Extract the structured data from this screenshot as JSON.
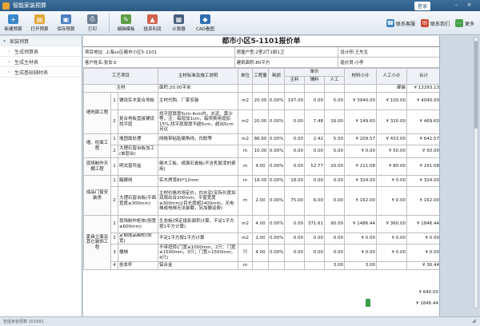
{
  "window": {
    "title": "智能家装预算",
    "login": "登录",
    "minimize": "–",
    "close": "×"
  },
  "toolbar": {
    "buttons": [
      {
        "label": "新建预算",
        "icon": "new-icon",
        "color": "#3a86c8",
        "glyph": "+"
      },
      {
        "label": "打开预算",
        "icon": "folder-icon",
        "color": "#e1a83a",
        "glyph": "▤"
      },
      {
        "label": "保存预算",
        "icon": "save-icon",
        "color": "#4a7fbf",
        "glyph": "▣"
      },
      {
        "label": "打印",
        "icon": "print-icon",
        "color": "#6b7d92",
        "glyph": "⎙"
      },
      {
        "label": "编辑模板",
        "icon": "edit-icon",
        "color": "#5f9c47",
        "glyph": "✎"
      },
      {
        "label": "投资利润",
        "icon": "chart-icon",
        "color": "#d0634a",
        "glyph": "▲"
      },
      {
        "label": "计算器",
        "icon": "calculator-icon",
        "color": "#4a5f7c",
        "glyph": "▦"
      },
      {
        "label": "CAD看图",
        "icon": "cad-icon",
        "color": "#2f6fb0",
        "glyph": "◆"
      }
    ],
    "right": [
      {
        "label": "联系客服",
        "icon": "service-icon",
        "color": "#3a86c8",
        "glyph": "☎"
      },
      {
        "label": "联系我们",
        "icon": "contact-icon",
        "color": "#d04a3a",
        "glyph": "✉"
      },
      {
        "label": "更多",
        "icon": "more-icon",
        "color": "#4aa04a",
        "glyph": "⋯"
      }
    ]
  },
  "sidebar": {
    "items": [
      {
        "label": "家装预算",
        "level": "top"
      },
      {
        "label": "生成预算表",
        "level": "sub"
      },
      {
        "label": "生成主材表",
        "level": "sub"
      },
      {
        "label": "生成基础辅材表",
        "level": "sub"
      }
    ]
  },
  "sheet": {
    "title": "都市小区5-1101报价单",
    "info1": {
      "addr": "项目地址: 上海xx区都市小区5-1101",
      "house": "房屋户型:2室2厅1厨1卫",
      "designer": "设计师:王先生"
    },
    "info2": {
      "client": "客户姓名:张女士",
      "area": "建筑面积:80平方",
      "auditor": "造价员:小李"
    },
    "headers": {
      "project": "工艺项目",
      "material": "主材标准及施工说明",
      "unit": "单位",
      "qty": "工程量",
      "loss": "耗损",
      "price": "单价",
      "main": "主料",
      "aux": "辅料",
      "labor": "人工",
      "mat_sub": "材料小计",
      "labor_sub": "人工小计",
      "total": "合计"
    },
    "rows": [
      {
        "cat": "主材",
        "no": "",
        "name": "",
        "desc": "面积:20.00平米",
        "unit": "",
        "qty": "",
        "loss": "",
        "main": "",
        "aux": "",
        "labor": "",
        "ms": "",
        "ls": "硬装",
        "total": "¥ 13293.13"
      },
      {
        "cat": "墙地面工程",
        "no": "1",
        "name": "铺设实木复合地板",
        "desc": "主材代购、厂家安装",
        "unit": "m2",
        "qty": "20.00",
        "loss": "0.00%",
        "main": "197.00",
        "aux": "0.00",
        "labor": "5.00",
        "ms": "¥ 3940.00",
        "ls": "¥ 100.00",
        "total": "¥ 4040.00"
      },
      {
        "cat": "",
        "no": "2",
        "name": "复合地板直接铺设找平层",
        "desc": "找平层厚度5cm-4cm内，水泥、黄沙等，注：每增加1cm，每项费用增加15%;找平层厚度不超5cm，超出5cm另议",
        "unit": "m2",
        "qty": "20.00",
        "loss": "0.00%",
        "main": "0.00",
        "aux": "7.48",
        "labor": "16.00",
        "ms": "¥ 149.60",
        "ls": "¥ 320.00",
        "total": "¥ 469.60"
      },
      {
        "cat": "墙、柱面工程",
        "no": "1",
        "name": "墙固面处理",
        "desc": "网格带粘贴偏角线，白胶等",
        "unit": "m2",
        "qty": "86.60",
        "loss": "0.00%",
        "main": "0.00",
        "aux": "2.42",
        "labor": "5.00",
        "ms": "¥ 209.57",
        "ls": "¥ 433.00",
        "total": "¥ 642.57"
      },
      {
        "cat": "",
        "no": "2",
        "name": "大理石窗台板加工(单层台)",
        "desc": "",
        "unit": "m",
        "qty": "10.00",
        "loss": "0.00%",
        "main": "0.00",
        "aux": "0.00",
        "labor": "5.00",
        "ms": "¥ 0.00",
        "ls": "¥ 50.00",
        "total": "¥ 50.00"
      },
      {
        "cat": "现场制作天棚工程",
        "no": "1",
        "name": "明式窗帘盒",
        "desc": "细木工板、纸面石膏板(不含乳胶漆的费用)",
        "unit": "m",
        "qty": "4.00",
        "loss": "0.00%",
        "main": "0.00",
        "aux": "52.77",
        "labor": "20.00",
        "ms": "¥ 211.08",
        "ls": "¥ 80.00",
        "total": "¥ 291.08"
      },
      {
        "cat": "成品门窗安装类",
        "no": "1",
        "name": "踢脚线",
        "desc": "实木烤漆80*12mm",
        "unit": "m",
        "qty": "18.00",
        "loss": "0.00%",
        "main": "18.00",
        "aux": "0.00",
        "labor": "0.00",
        "ms": "¥ 324.00",
        "ls": "¥ 0.00",
        "total": "¥ 324.00"
      },
      {
        "cat": "",
        "no": "2",
        "name": "大理石窗台板(平面宽度≤300mm)",
        "desc": "主材价格市场定价，白水泥(实际长度如双周出台200mm，平窗宽度≤300mm)(目长度超2400mm，无电梯或电梯无法装载，另加搬运费)",
        "unit": "m",
        "qty": "2.00",
        "loss": "0.00%",
        "main": "75.00",
        "aux": "6.00",
        "labor": "0.00",
        "ms": "¥ 162.00",
        "ls": "¥ 0.00",
        "total": "¥ 162.00"
      },
      {
        "cat": "家具立面及其它装饰工程",
        "no": "1",
        "name": "现场制作柜体(刨宽≤600mm)",
        "desc": "生态板(饰定投影面积计算，不足1平方按1平方计算)",
        "unit": "m2",
        "qty": "4.00",
        "loss": "0.00%",
        "main": "0.00",
        "aux": "371.61",
        "labor": "90.00",
        "ms": "¥ 1486.44",
        "ls": "¥ 360.00",
        "total": "¥ 1846.44"
      },
      {
        "cat": "",
        "no": "2",
        "name": "定制成品橱柜(刨宽)",
        "desc": "不足1平方按1平方计算",
        "unit": "m2",
        "qty": "2.00",
        "loss": "0.00%",
        "main": "0.00",
        "aux": "0.00",
        "labor": "0.00",
        "ms": "¥ 0.00",
        "ls": "¥ 0.00",
        "total": "¥ 0.00"
      },
      {
        "cat": "",
        "no": "3",
        "name": "楼梯",
        "desc": "不带扭转(门宽≤1000mm，2只：门宽≤1500mm，3只；门宽>1500mm，4只)",
        "unit": "只",
        "qty": "4.00",
        "loss": "0.00%",
        "main": "0.00",
        "aux": "0.00",
        "labor": "0.00",
        "ms": "¥ 0.00",
        "ls": "¥ 0.00",
        "total": "¥ 0.00"
      },
      {
        "cat": "",
        "no": "4",
        "name": "挂衣杆",
        "desc": "铝合金",
        "unit": "m",
        "qty": "",
        "loss": "",
        "main": "",
        "aux": "",
        "labor": "3.00",
        "ms": "3.00",
        "ls": "",
        "total": "¥ 36.44"
      }
    ],
    "extra_totals": [
      "¥ 640.00",
      "¥ 1846.44"
    ]
  },
  "status": {
    "text": "智能家装预算 2018R1"
  }
}
